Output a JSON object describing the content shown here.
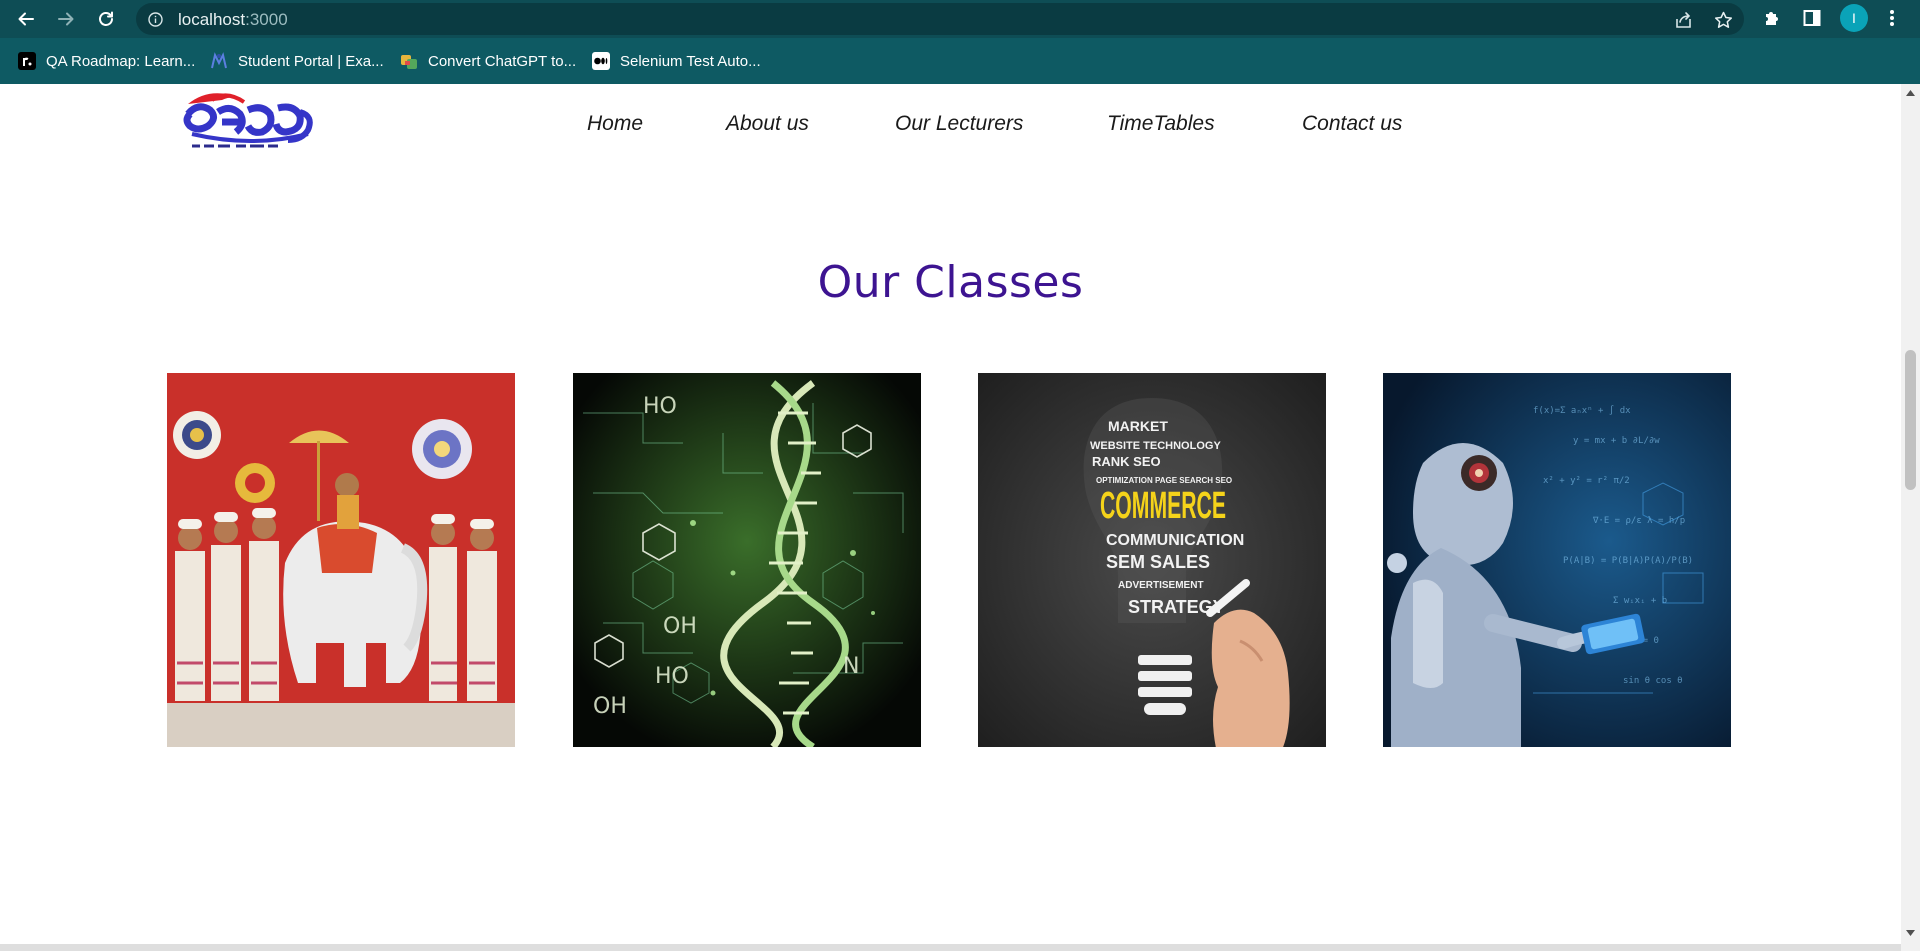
{
  "browser": {
    "url_host": "localhost",
    "url_port": ":3000",
    "profile_initial": "I",
    "bookmarks": [
      {
        "label": "QA Roadmap: Learn...",
        "icon": "roadmap-favicon"
      },
      {
        "label": "Student Portal | Exa...",
        "icon": "student-portal-favicon"
      },
      {
        "label": "Convert ChatGPT to...",
        "icon": "convert-favicon"
      },
      {
        "label": "Selenium Test Auto...",
        "icon": "medium-favicon"
      }
    ],
    "colors": {
      "toolbar": "#0e4d55",
      "bookmarks_bar": "#0e5a63"
    }
  },
  "site": {
    "nav": [
      "Home",
      "About us",
      "Our Lecturers",
      "TimeTables",
      "Contact us"
    ],
    "section_title": "Our Classes",
    "accent_color": "#3d1491",
    "classes": [
      {
        "icon": "sinhala-art-image"
      },
      {
        "icon": "science-dna-image"
      },
      {
        "icon": "commerce-image",
        "word": "COMMERCE"
      },
      {
        "icon": "technology-robot-image"
      }
    ]
  }
}
